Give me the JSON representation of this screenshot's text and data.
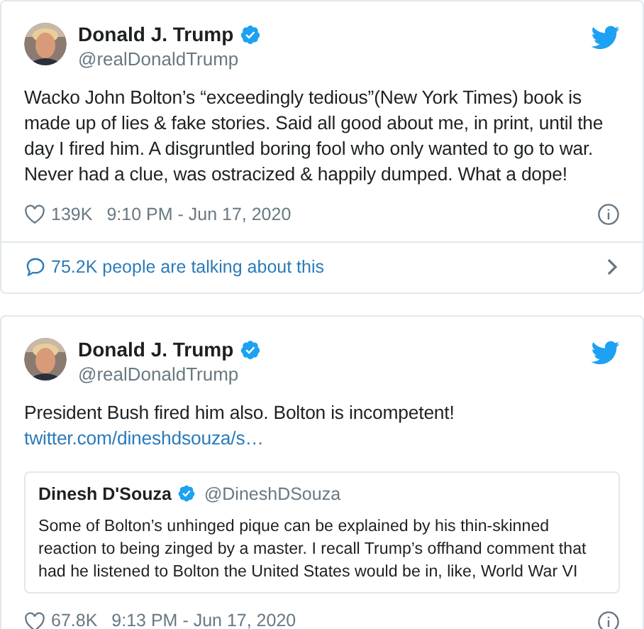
{
  "tweets": [
    {
      "author": {
        "name": "Donald J. Trump",
        "handle": "@realDonaldTrump",
        "verified": true
      },
      "text": "Wacko John Bolton’s “exceedingly tedious”(New York Times) book is made up of lies & fake stories. Said all good about me, in print, until the day I fired him. A disgruntled boring fool who only wanted to go to war. Never had a clue, was ostracized & happily dumped. What a dope!",
      "likes": "139K",
      "timestamp": "9:10 PM - Jun 17, 2020",
      "conversation": "75.2K people are talking about this"
    },
    {
      "author": {
        "name": "Donald J. Trump",
        "handle": "@realDonaldTrump",
        "verified": true
      },
      "text": "President Bush fired him also. Bolton is incompetent!",
      "link": "twitter.com/dineshdsouza/s…",
      "quoted": {
        "name": "Dinesh D'Souza",
        "handle": "@DineshDSouza",
        "verified": true,
        "text": "Some of Bolton’s unhinged pique can be explained by his thin-skinned reaction to being zinged by a master. I recall Trump’s offhand comment that had he listened to Bolton the United States would be in, like, World War VI"
      },
      "likes": "67.8K",
      "timestamp": "9:13 PM - Jun 17, 2020"
    }
  ]
}
